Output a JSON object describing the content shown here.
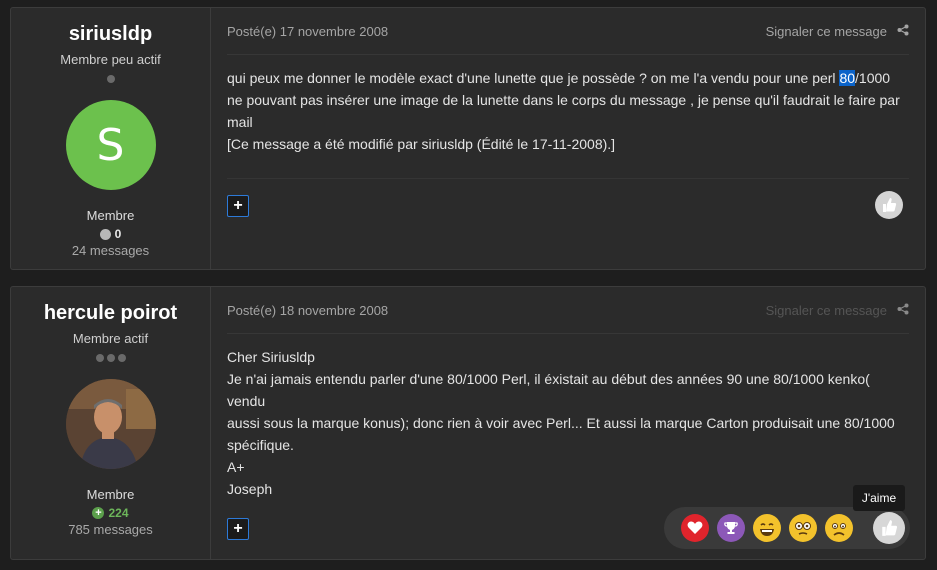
{
  "posts": [
    {
      "author": {
        "name": "siriusldp",
        "title": "Membre peu actif",
        "avatar_letter": "S",
        "avatar_color": "#6cc14d",
        "group": "Membre",
        "reputation": "0",
        "count": "24 messages"
      },
      "date": "Posté(e) 17 novembre 2008",
      "report": "Signaler ce message",
      "body": {
        "l1a": "qui peux me donner le modèle exact d'une lunette que je possède ? on me l'a vendu pour une perl ",
        "l1hl": "80",
        "l1b": "/1000",
        "l2": "ne pouvant pas insérer une image de la lunette dans le corps du message , je pense qu'il faudrait le faire par",
        "l3": "mail",
        "l4": "[Ce message a été modifié par siriusldp (Édité le 17-11-2008).]"
      }
    },
    {
      "author": {
        "name": "hercule poirot",
        "title": "Membre actif",
        "group": "Membre",
        "reputation": "224",
        "count": "785 messages"
      },
      "date": "Posté(e) 18 novembre 2008",
      "report": "Signaler ce message",
      "body": {
        "l1": "Cher Siriusldp",
        "l2": "Je n'ai jamais entendu parler d'une 80/1000 Perl, il éxistait au début des années 90 une 80/1000 kenko( vendu",
        "l3": "aussi sous la marque konus); donc rien à voir avec Perl... Et aussi la marque Carton produisait une 80/1000",
        "l4": "spécifique.",
        "l5": "A+",
        "l6": "Joseph"
      }
    }
  ],
  "tooltip": "J'aime",
  "reactions": [
    "heart-icon",
    "trophy-icon",
    "laugh-icon",
    "confused-icon",
    "sad-icon",
    "like-icon"
  ],
  "colors": {
    "accent": "#2d7ad8",
    "reputation_positive": "#6cb55a"
  }
}
